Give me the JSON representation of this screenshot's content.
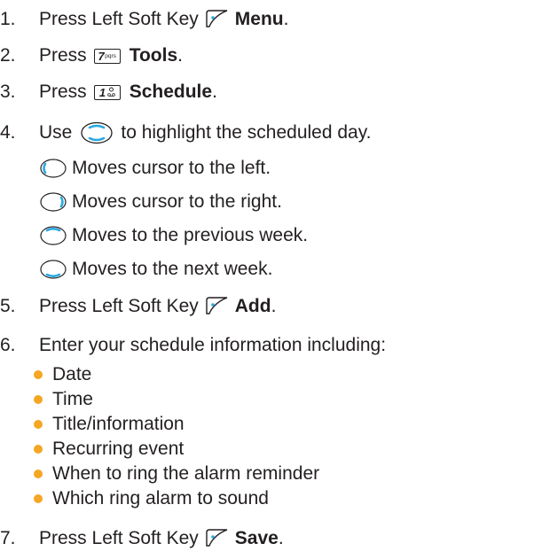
{
  "steps": [
    {
      "num": "1.",
      "pre": "Press Left Soft Key",
      "icon": "left-soft-key-icon",
      "bold": "Menu",
      "post": "."
    },
    {
      "num": "2.",
      "pre": "Press",
      "key": {
        "digit": "7",
        "letters": "pqrs"
      },
      "bold": "Tools",
      "post": "."
    },
    {
      "num": "3.",
      "pre": "Press",
      "key": {
        "digit": "1",
        "letters": "@ ..."
      },
      "bold": "Schedule",
      "post": "."
    },
    {
      "num": "4.",
      "pre": "Use",
      "icon": "navigation-key-icon",
      "post": "to highlight the scheduled day."
    },
    {
      "num": "5.",
      "pre": "Press Left Soft Key",
      "icon": "left-soft-key-icon",
      "bold": "Add",
      "post": "."
    },
    {
      "num": "6.",
      "text": "Enter your schedule information including:"
    },
    {
      "num": "7.",
      "pre": "Press Left Soft Key",
      "icon": "left-soft-key-icon",
      "bold": "Save",
      "post": "."
    }
  ],
  "nav_moves": [
    {
      "icon": "nav-left-icon",
      "text": "Moves cursor to the left."
    },
    {
      "icon": "nav-right-icon",
      "text": "Moves cursor to the right."
    },
    {
      "icon": "nav-up-icon",
      "text": "Moves to the previous week."
    },
    {
      "icon": "nav-down-icon",
      "text": "Moves to the next week."
    }
  ],
  "schedule_fields": [
    "Date",
    "Time",
    "Title/information",
    "Recurring event",
    "When to ring the alarm reminder",
    "Which ring alarm to sound"
  ],
  "colors": {
    "text": "#231f20",
    "bullet": "#f5a623",
    "nav_accent": "#29a8e0"
  }
}
